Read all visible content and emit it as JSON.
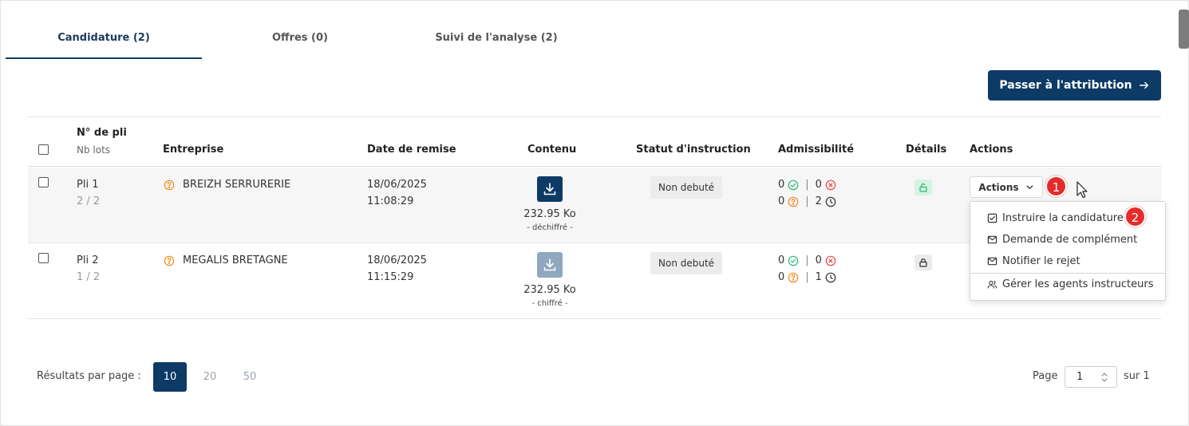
{
  "tabs": [
    {
      "label": "Candidature (2)"
    },
    {
      "label": "Offres (0)"
    },
    {
      "label": "Suivi de l'analyse (2)"
    }
  ],
  "primary_button": {
    "label": "Passer à l'attribution"
  },
  "table": {
    "headers": {
      "pli": "N° de pli",
      "nb_lots": "Nb lots",
      "entreprise": "Entreprise",
      "date": "Date de remise",
      "contenu": "Contenu",
      "statut": "Statut d'instruction",
      "admissibilite": "Admissibilité",
      "details": "Détails",
      "actions": "Actions"
    },
    "rows": [
      {
        "pli": "Pli 1",
        "lots": "2 / 2",
        "company": "BREIZH SERRURERIE",
        "date": "18/06/2025",
        "time": "11:08:29",
        "size": "232.95 Ko",
        "encryption": "- déchiffré -",
        "status": "Non debuté",
        "adm": {
          "ok": "0",
          "ko": "0",
          "unknown": "0",
          "pending": "2"
        }
      },
      {
        "pli": "Pli 2",
        "lots": "1 / 2",
        "company": "MEGALIS BRETAGNE",
        "date": "18/06/2025",
        "time": "11:15:29",
        "size": "232.95 Ko",
        "encryption": "- chiffré -",
        "status": "Non debuté",
        "adm": {
          "ok": "0",
          "ko": "0",
          "unknown": "0",
          "pending": "1"
        }
      }
    ]
  },
  "actions_button": {
    "label": "Actions"
  },
  "steps": {
    "one": "1",
    "two": "2"
  },
  "actions_menu": {
    "items": [
      {
        "label": "Instruire la candidature"
      },
      {
        "label": "Demande de complément"
      },
      {
        "label": "Notifier le rejet"
      },
      {
        "label": "Gérer les agents instructeurs"
      }
    ]
  },
  "pagination": {
    "per_page_label": "Résultats par page :",
    "options": [
      "10",
      "20",
      "50"
    ],
    "selected": "10",
    "page_label": "Page",
    "page_value": "1",
    "of_label": "sur 1"
  },
  "colors": {
    "brand": "#0d3b66",
    "success": "#2db87b",
    "error": "#e84a4a",
    "warning": "#f08a24",
    "step": "#e52b2b"
  }
}
